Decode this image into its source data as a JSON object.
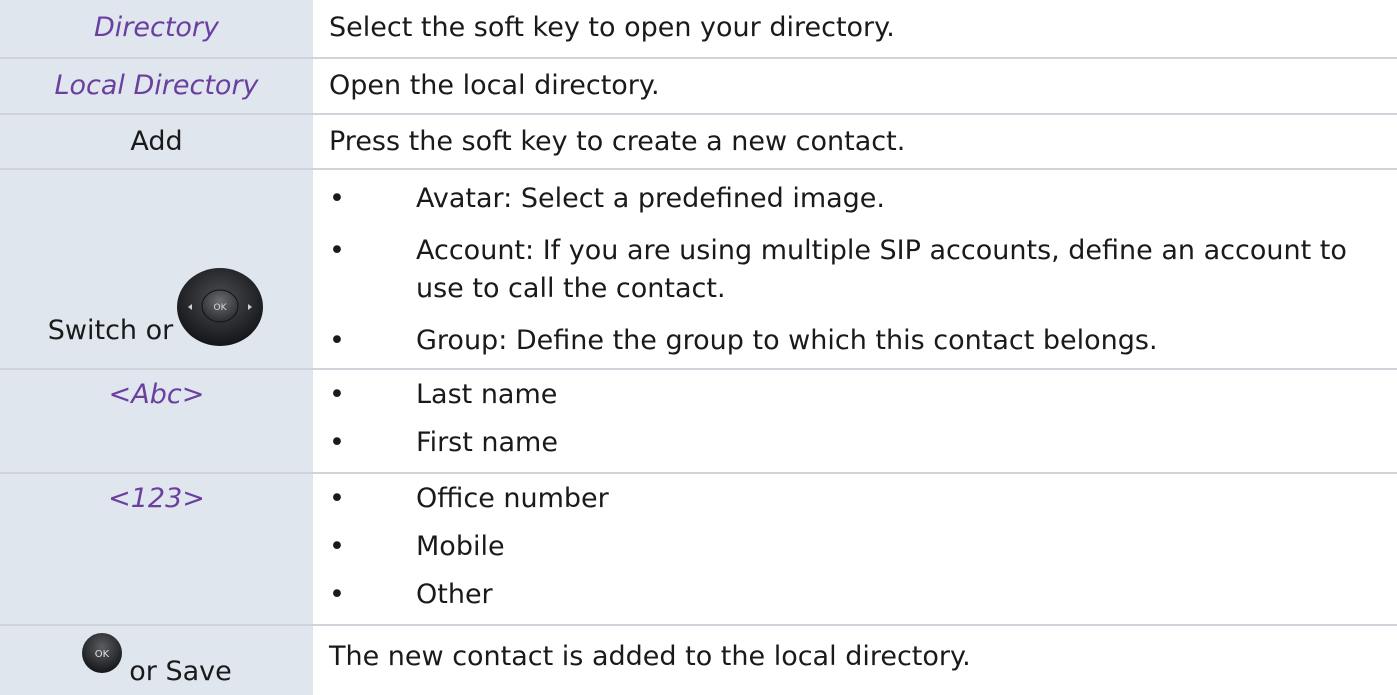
{
  "rows": [
    {
      "key": "Directory",
      "description": "Select the soft key to open your directory."
    },
    {
      "key": "Local Directory",
      "description": "Open the local directory."
    },
    {
      "key": "Add",
      "description": "Press the soft key to create a new contact."
    },
    {
      "key": "Switch or",
      "key_icon": "navigation-pad-ok-icon",
      "bullets": [
        "Avatar: Select a predefined image.",
        "Account: If you are using multiple SIP accounts, define an account to use to call the contact.",
        "Group: Define the group to which this contact belongs."
      ]
    },
    {
      "key": "<Abc>",
      "bullets": [
        "Last name",
        "First name"
      ]
    },
    {
      "key": "<123>",
      "bullets": [
        "Office number",
        "Mobile",
        "Other"
      ]
    },
    {
      "key": "or Save",
      "key_icon": "ok-button-icon",
      "description": "The new contact is added to the local directory."
    }
  ],
  "bullet_char": "•",
  "icons": {
    "nav_ok_label": "OK",
    "ok_label": "OK"
  },
  "colors": {
    "key_background": "#dfe6ee",
    "italic_key_text": "#6b3fa0",
    "row_divider": "#d0d4da"
  }
}
